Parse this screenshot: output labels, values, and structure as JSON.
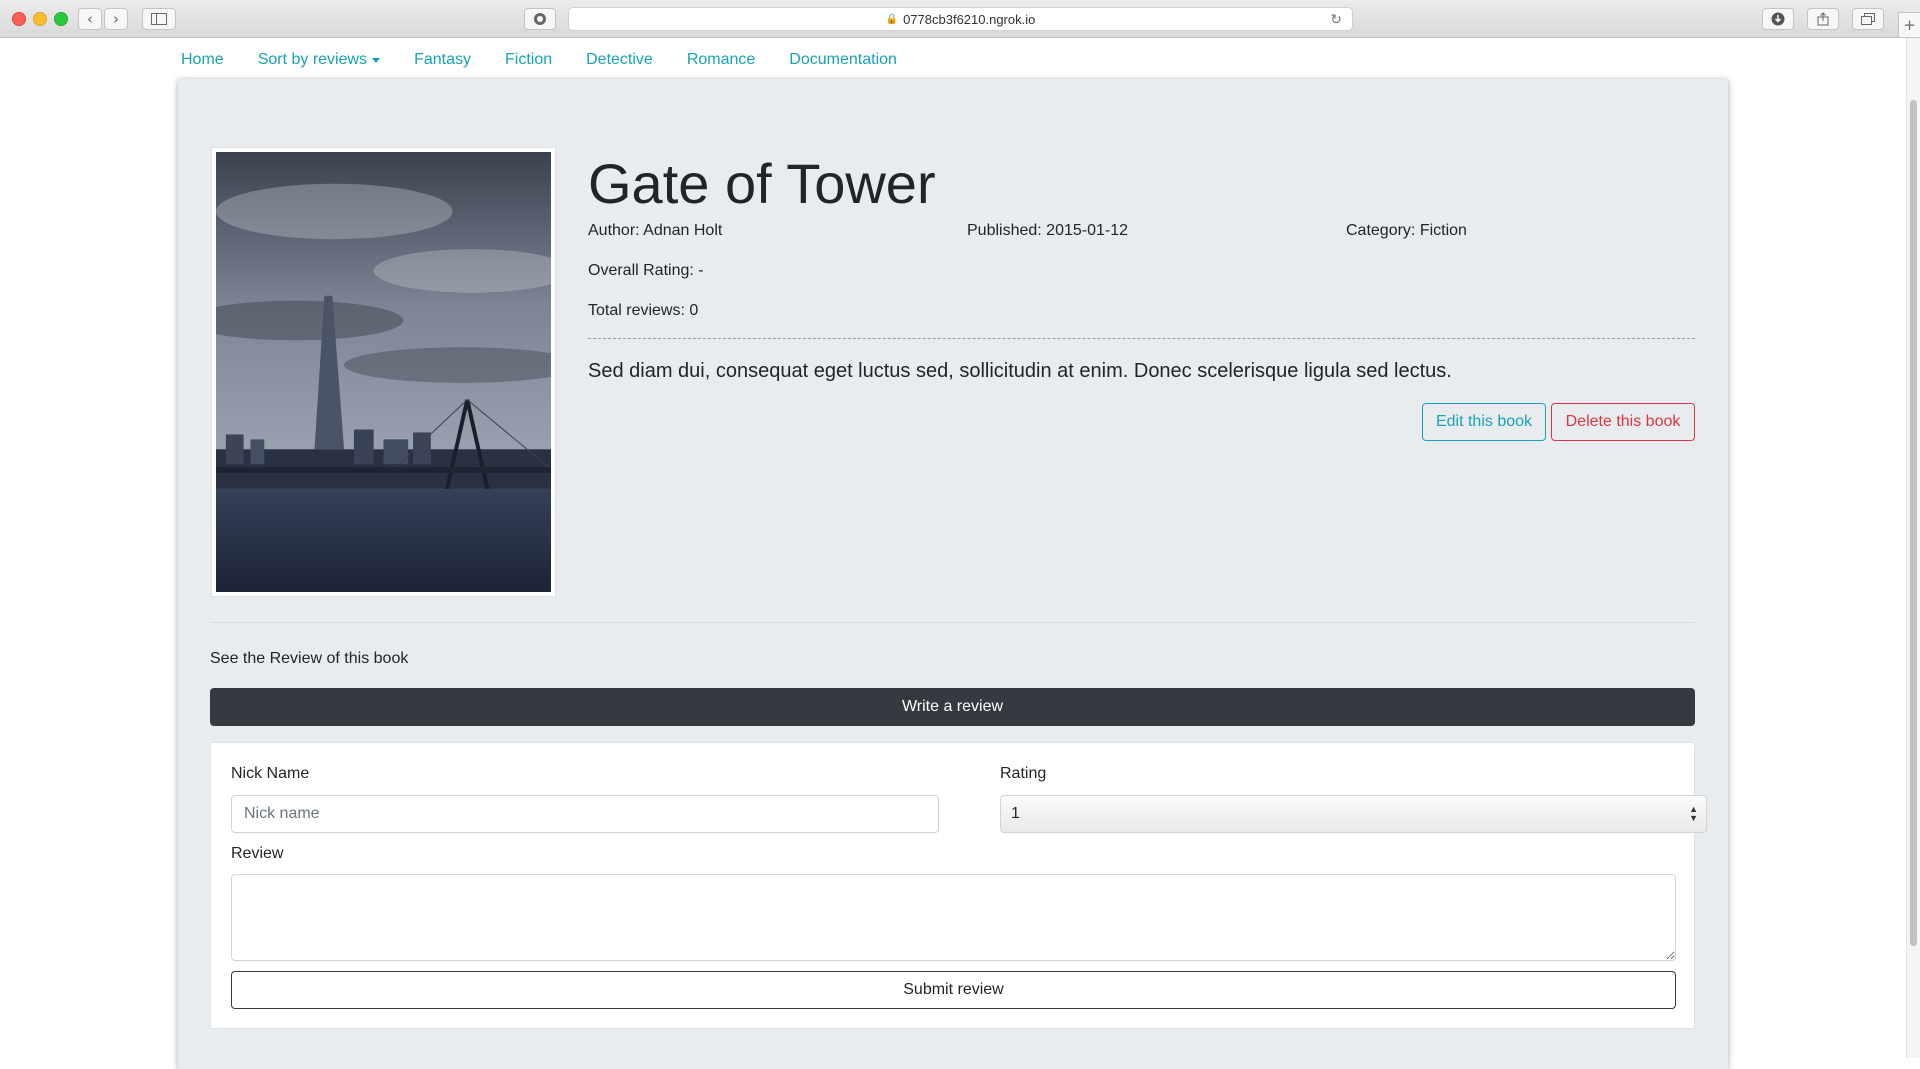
{
  "browser": {
    "url": "0778cb3f6210.ngrok.io",
    "icons": {
      "back": "chevron-left-icon",
      "forward": "chevron-right-icon",
      "sidebar": "sidebar-icon",
      "extension": "extension-icon",
      "reload": "reload-icon",
      "download": "download-icon",
      "share": "share-icon",
      "tabs": "tabs-icon",
      "new_tab": "plus-icon"
    }
  },
  "nav": {
    "home": "Home",
    "sort": "Sort by reviews",
    "fantasy": "Fantasy",
    "fiction": "Fiction",
    "detective": "Detective",
    "romance": "Romance",
    "documentation": "Documentation"
  },
  "book": {
    "title": "Gate of Tower",
    "author": "Author: Adnan Holt",
    "published": "Published: 2015-01-12",
    "category": "Category: Fiction",
    "overall_rating": "Overall Rating: -",
    "total_reviews": "Total reviews: 0",
    "description": "Sed diam dui, consequat eget luctus sed, sollicitudin at enim. Donec scelerisque ligula sed lectus.",
    "edit_label": "Edit this book",
    "delete_label": "Delete this book"
  },
  "reviews": {
    "see_label": "See the Review of this book",
    "write_label": "Write a review",
    "nick_label": "Nick Name",
    "nick_placeholder": "Nick name",
    "rating_label": "Rating",
    "rating_value": "1",
    "review_label": "Review",
    "submit_label": "Submit review"
  },
  "colors": {
    "accent": "#17a2b8",
    "danger": "#dc3545",
    "dark": "#343a40",
    "panel": "#e9ecef"
  }
}
